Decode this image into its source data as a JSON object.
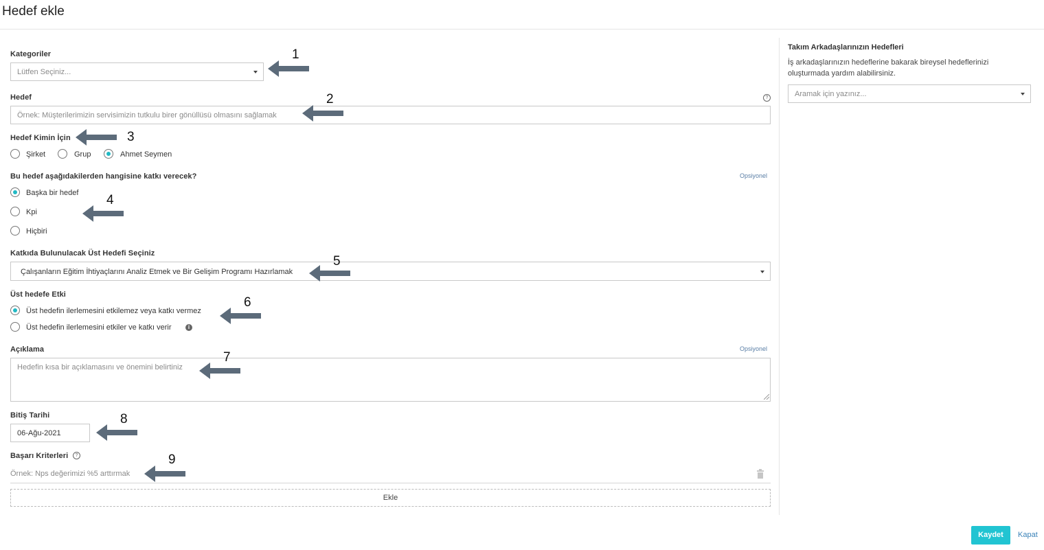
{
  "page": {
    "title": "Hedef ekle"
  },
  "form": {
    "kategoriler": {
      "label": "Kategoriler",
      "placeholder": "Lütfen Seçiniz..."
    },
    "hedef": {
      "label": "Hedef",
      "placeholder": "Örnek: Müşterilerimizin servisimizin tutkulu birer gönüllüsü olmasını sağlamak"
    },
    "hedef_kimin": {
      "label": "Hedef Kimin İçin",
      "options": [
        "Şirket",
        "Grup",
        "Ahmet Seymen"
      ],
      "selected": "Ahmet Seymen"
    },
    "katki": {
      "label": "Bu hedef aşağıdakilerden hangisine katkı verecek?",
      "optional": "Opsiyonel",
      "options": [
        "Başka bir hedef",
        "Kpi",
        "Hiçbiri"
      ],
      "selected": "Başka bir hedef"
    },
    "ust_hedef": {
      "label": "Katkıda Bulunulacak Üst Hedefi Seçiniz",
      "value": "Çalışanların Eğitim İhtiyaçlarını Analiz Etmek ve Bir Gelişim Programı Hazırlamak"
    },
    "ust_etki": {
      "label": "Üst hedefe Etki",
      "options": [
        "Üst hedefin ilerlemesini etkilemez veya katkı vermez",
        "Üst hedefin ilerlemesini etkiler ve katkı verir"
      ],
      "selected": "Üst hedefin ilerlemesini etkilemez veya katkı vermez"
    },
    "aciklama": {
      "label": "Açıklama",
      "optional": "Opsiyonel",
      "placeholder": "Hedefin kısa bir açıklamasını ve önemini belirtiniz"
    },
    "bitis": {
      "label": "Bitiş Tarihi",
      "value": "06-Ağu-2021"
    },
    "basari": {
      "label": "Başarı Kriterleri",
      "placeholder": "Örnek: Nps değerimizi %5 arttırmak",
      "add_label": "Ekle"
    }
  },
  "side": {
    "title": "Takım Arkadaşlarınızın Hedefleri",
    "desc": "İş arkadaşlarınızın hedeflerine bakarak bireysel hedeflerinizi oluşturmada yardım alabilirsiniz.",
    "search_placeholder": "Aramak için yazınız..."
  },
  "footer": {
    "save": "Kaydet",
    "close": "Kapat"
  },
  "annotations": [
    "1",
    "2",
    "3",
    "4",
    "5",
    "6",
    "7",
    "8",
    "9"
  ],
  "colors": {
    "accent": "#21c4d2",
    "arrow": "#5c6b7a",
    "link": "#3a82b8"
  }
}
